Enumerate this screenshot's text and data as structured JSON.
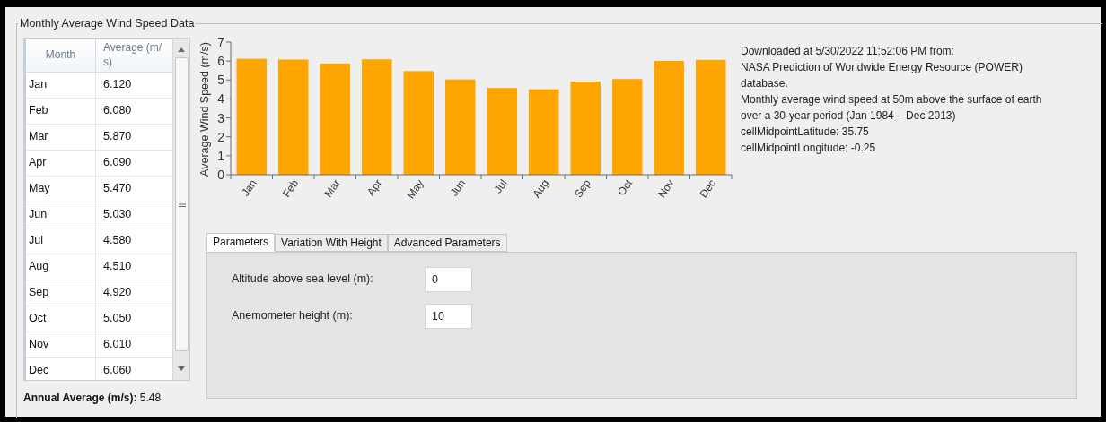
{
  "group_title": "Monthly Average Wind Speed Data",
  "table": {
    "columns": [
      "Month",
      "Average (m/ s)"
    ],
    "rows": [
      [
        "Jan",
        "6.120"
      ],
      [
        "Feb",
        "6.080"
      ],
      [
        "Mar",
        "5.870"
      ],
      [
        "Apr",
        "6.090"
      ],
      [
        "May",
        "5.470"
      ],
      [
        "Jun",
        "5.030"
      ],
      [
        "Jul",
        "4.580"
      ],
      [
        "Aug",
        "4.510"
      ],
      [
        "Sep",
        "4.920"
      ],
      [
        "Oct",
        "5.050"
      ],
      [
        "Nov",
        "6.010"
      ],
      [
        "Dec",
        "6.060"
      ]
    ]
  },
  "annual_average": "**Annual Average (m/s):** 5.48",
  "chart": {
    "chart_data": {
      "type": "bar",
      "ylabel": "Average Wind Speed (m/s)",
      "categories": [
        "Jan",
        "Feb",
        "Mar",
        "Apr",
        "May",
        "Jun",
        "Jul",
        "Aug",
        "Sep",
        "Oct",
        "Nov",
        "Dec"
      ],
      "series": [
        {
          "color": "#ffa500",
          "values": [
            6.12,
            6.08,
            5.87,
            6.09,
            5.47,
            5.03,
            4.58,
            4.51,
            4.92,
            5.05,
            6.01,
            6.06
          ]
        }
      ],
      "ylim": [
        0,
        7
      ],
      "yticks": [
        0,
        1,
        2,
        3,
        4,
        5,
        6,
        7
      ]
    }
  },
  "info_lines": [
    "Downloaded at 5/30/2022 11:52:06 PM from:",
    "NASA Prediction of Worldwide Energy Resource (POWER) database.",
    "Monthly average wind speed at 50m above the surface of earth over a 30-year period (Jan 1984 – Dec 2013)",
    "cellMidpointLatitude: 35.75",
    "cellMidpointLongitude: -0.25"
  ],
  "tabs": [
    {
      "label": "Parameters",
      "selected": true
    },
    {
      "label": "Variation With Height",
      "selected": false
    },
    {
      "label": "Advanced Parameters",
      "selected": false
    }
  ],
  "fields": [
    {
      "label": "Altitude above sea level (m):",
      "value": "0"
    },
    {
      "label": "Anemometer height (m):",
      "value": "10"
    }
  ]
}
